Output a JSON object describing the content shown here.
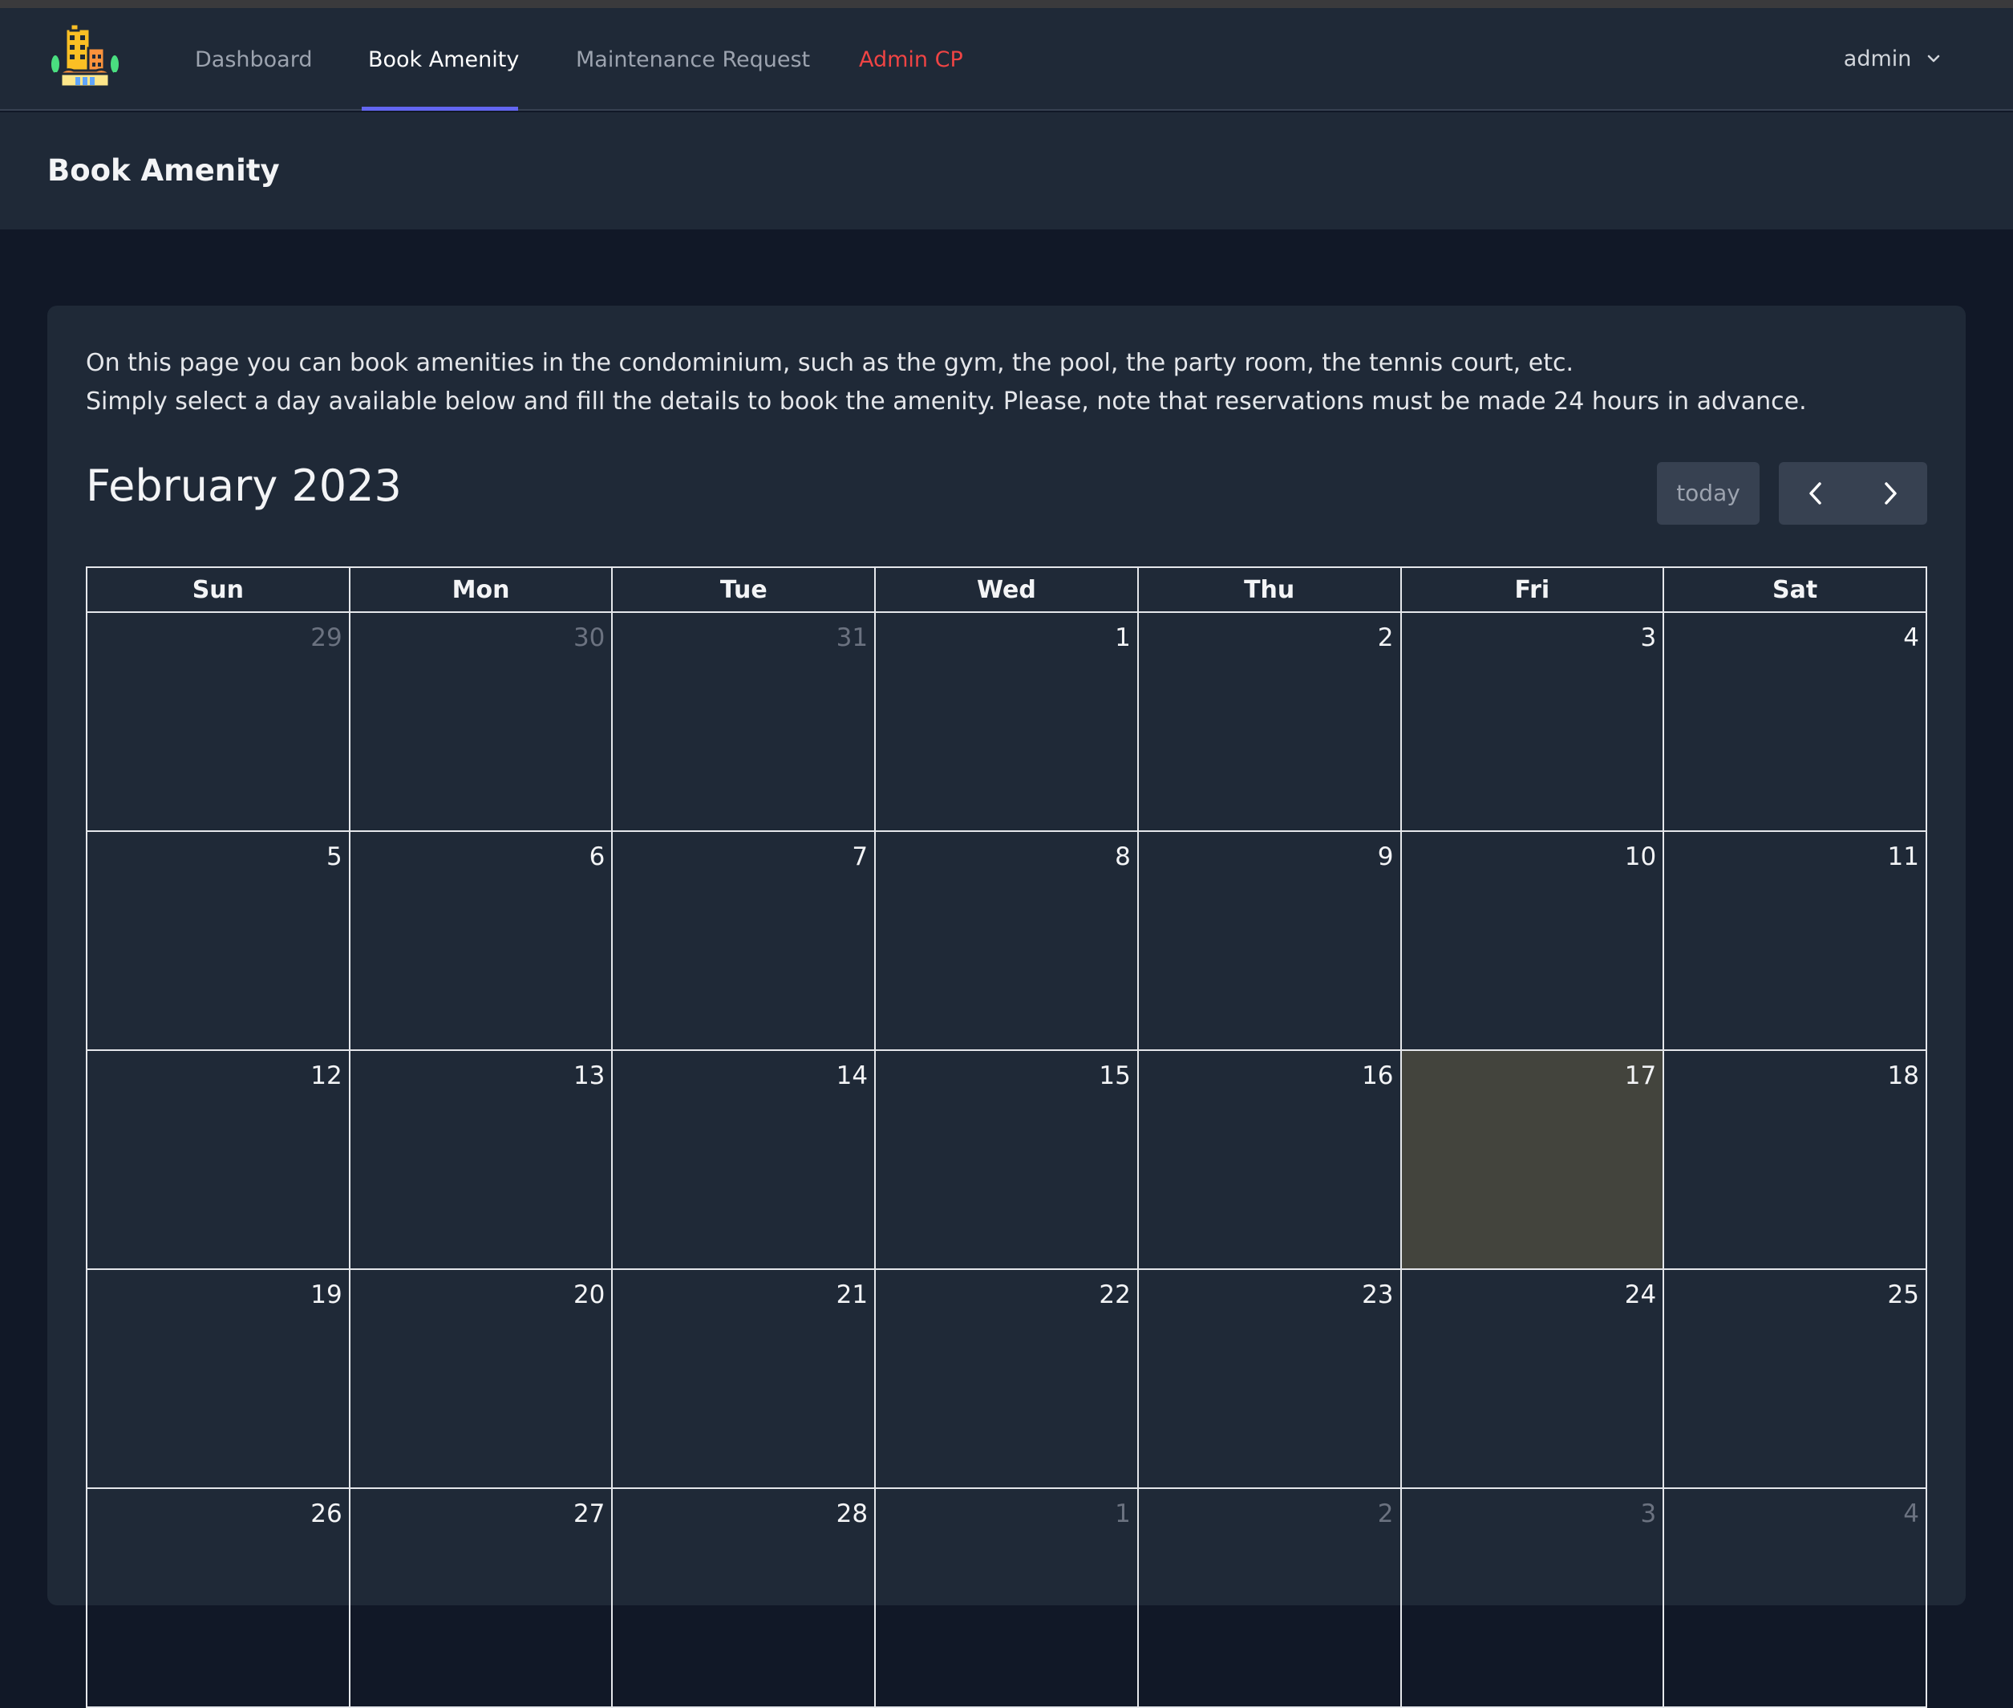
{
  "nav": {
    "items": [
      {
        "label": "Dashboard"
      },
      {
        "label": "Book Amenity"
      },
      {
        "label": "Maintenance Request"
      },
      {
        "label": "Admin CP"
      }
    ],
    "active_index": 1,
    "user": "admin"
  },
  "page": {
    "title": "Book Amenity"
  },
  "intro": {
    "line1": "On this page you can book amenities in the condominium, such as the gym, the pool, the party room, the tennis court, etc.",
    "line2": "Simply select a day available below and fill the details to book the amenity. Please, note that reservations must be made 24 hours in advance."
  },
  "calendar": {
    "title": "February 2023",
    "today_label": "today",
    "weekdays": [
      "Sun",
      "Mon",
      "Tue",
      "Wed",
      "Thu",
      "Fri",
      "Sat"
    ],
    "weeks": [
      [
        "29",
        "30",
        "31",
        "1",
        "2",
        "3",
        "4"
      ],
      [
        "5",
        "6",
        "7",
        "8",
        "9",
        "10",
        "11"
      ],
      [
        "12",
        "13",
        "14",
        "15",
        "16",
        "17",
        "18"
      ],
      [
        "19",
        "20",
        "21",
        "22",
        "23",
        "24",
        "25"
      ],
      [
        "26",
        "27",
        "28",
        "1",
        "2",
        "3",
        "4"
      ]
    ],
    "highlighted_day": "17"
  },
  "colors": {
    "accent": "#6366f1",
    "admin": "#ef4444",
    "today_bg": "#43443d"
  },
  "icons": {
    "logo": "condominium-building-logo",
    "user_dropdown": "chevron-down-icon",
    "prev": "chevron-left-icon",
    "next": "chevron-right-icon"
  }
}
